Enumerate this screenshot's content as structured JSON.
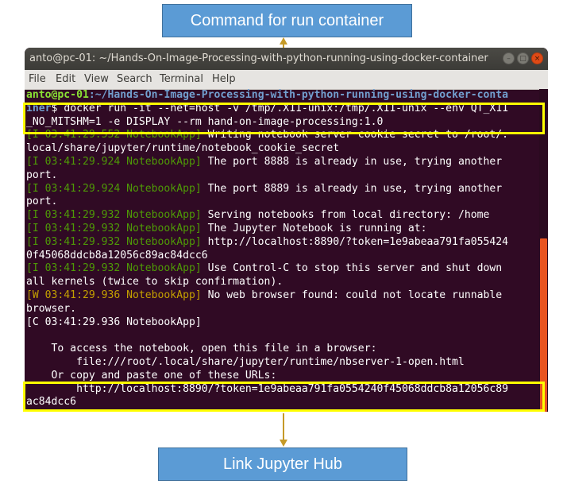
{
  "annotations": {
    "top_label": "Command for run container",
    "bottom_label": "Link Jupyter Hub"
  },
  "window": {
    "title": "anto@pc-01: ~/Hands-On-Image-Processing-with-python-running-using-docker-container",
    "buttons": {
      "minimize": "–",
      "maximize": "□",
      "close": "×"
    }
  },
  "menubar": {
    "items": [
      "File",
      "Edit",
      "View",
      "Search",
      "Terminal",
      "Help"
    ]
  },
  "terminal": {
    "prompt_user": "anto@pc-01",
    "prompt_path": ":~/Hands-On-Image-Processing-with-python-running-using-docker-conta",
    "prompt_path_cont": "iner",
    "command_line_1": "$ docker run -it --net=host -v /tmp/.X11-unix:/tmp/.X11-unix --env QT_X11",
    "command_line_2": "_NO_MITSHM=1 -e DISPLAY --rm hand-on-image-processing:1.0",
    "log": [
      {
        "prefix": "[I 03:41:29.552 NotebookApp]",
        "level": "I",
        "text": " Writing notebook server cookie secret to /root/."
      },
      {
        "prefix": "",
        "level": "",
        "text": "local/share/jupyter/runtime/notebook_cookie_secret"
      },
      {
        "prefix": "[I 03:41:29.924 NotebookApp]",
        "level": "I",
        "text": " The port 8888 is already in use, trying another"
      },
      {
        "prefix": "",
        "level": "",
        "text": "port."
      },
      {
        "prefix": "[I 03:41:29.924 NotebookApp]",
        "level": "I",
        "text": " The port 8889 is already in use, trying another"
      },
      {
        "prefix": "",
        "level": "",
        "text": "port."
      },
      {
        "prefix": "[I 03:41:29.932 NotebookApp]",
        "level": "I",
        "text": " Serving notebooks from local directory: /home"
      },
      {
        "prefix": "[I 03:41:29.932 NotebookApp]",
        "level": "I",
        "text": " The Jupyter Notebook is running at:"
      },
      {
        "prefix": "[I 03:41:29.932 NotebookApp]",
        "level": "I",
        "text": " http://localhost:8890/?token=1e9abeaa791fa055424"
      },
      {
        "prefix": "",
        "level": "",
        "text": "0f45068ddcb8a12056c89ac84dcc6"
      },
      {
        "prefix": "[I 03:41:29.932 NotebookApp]",
        "level": "I",
        "text": " Use Control-C to stop this server and shut down"
      },
      {
        "prefix": "",
        "level": "",
        "text": "all kernels (twice to skip confirmation)."
      },
      {
        "prefix": "[W 03:41:29.936 NotebookApp]",
        "level": "W",
        "text": " No web browser found: could not locate runnable"
      },
      {
        "prefix": "",
        "level": "",
        "text": "browser."
      },
      {
        "prefix": "",
        "level": "",
        "text": "[C 03:41:29.936 NotebookApp]"
      },
      {
        "prefix": "",
        "level": "",
        "text": ""
      },
      {
        "prefix": "",
        "level": "",
        "text": "    To access the notebook, open this file in a browser:"
      },
      {
        "prefix": "",
        "level": "",
        "text": "        file:///root/.local/share/jupyter/runtime/nbserver-1-open.html"
      },
      {
        "prefix": "",
        "level": "",
        "text": "    Or copy and paste one of these URLs:"
      }
    ],
    "url_line_1": "        http://localhost:8890/?token=1e9abeaa791fa0554240f45068ddcb8a12056c89",
    "url_line_2": "ac84dcc6"
  },
  "colors": {
    "terminal_bg": "#300a24",
    "highlight": "#ffff00",
    "callout_bg": "#5b9bd5",
    "arrow": "#c59a28",
    "info_green": "#4e9a06",
    "warn_yellow": "#c4a000"
  }
}
